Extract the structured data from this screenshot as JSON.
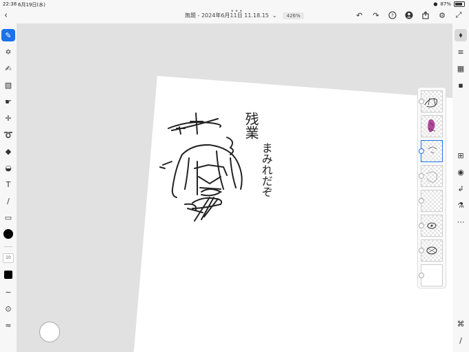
{
  "status_bar": {
    "time": "22:38",
    "date": "6月19日(水)",
    "battery": "87%"
  },
  "header": {
    "title": "無題 - 2024年6月11日 11.18.15",
    "zoom": "426%"
  },
  "left_toolbar": {
    "brush_size": "10"
  },
  "artwork": {
    "text_lines": [
      "残業",
      "まみれだぞ"
    ]
  },
  "colors": {
    "accent": "#1a73e8",
    "canvas_bg": "#e1e1e1",
    "paper": "#ffffff",
    "toolbar_bg": "#f7f7f7"
  },
  "icons": {
    "top_actions": [
      "undo-icon",
      "redo-icon",
      "help-icon",
      "account-icon",
      "share-icon",
      "settings-icon",
      "fullscreen-icon"
    ],
    "right_tools": [
      "layers-icon",
      "adjustments-icon",
      "grid-icon",
      "comments-icon",
      "add-layer-icon",
      "visibility-icon",
      "import-icon",
      "blend-icon",
      "more-icon",
      "tools-icon",
      "ruler-icon"
    ]
  }
}
